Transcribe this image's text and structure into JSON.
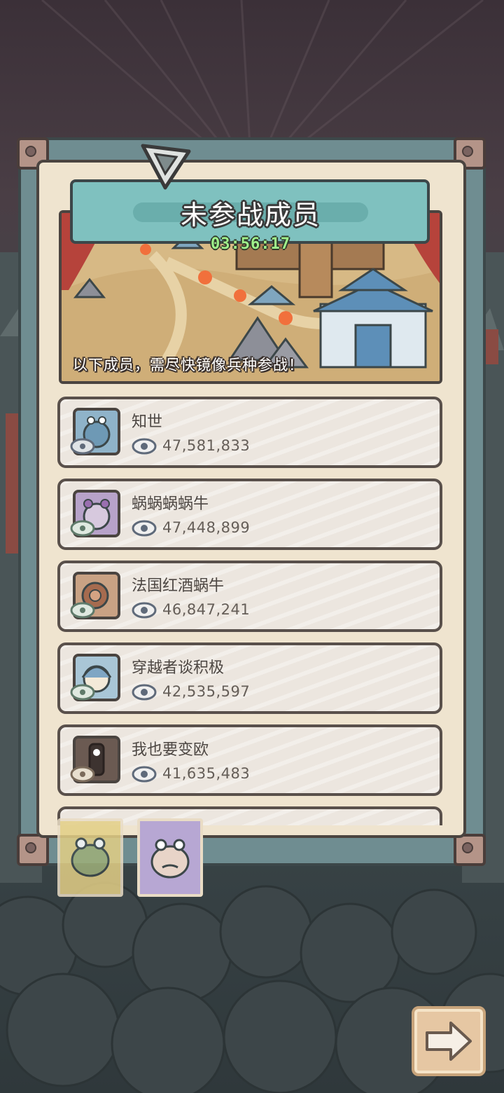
{
  "header": {
    "title": "未参战成员",
    "timer": "03:56:17",
    "caption": "以下成员，需尽快镜像兵种参战！"
  },
  "members": [
    {
      "name": "知世",
      "views": "47,581,833",
      "avatar_color": "#8fb3c9",
      "avatar_icon": "blue-snail-icon"
    },
    {
      "name": "蜗蜗蜗蜗牛",
      "views": "47,448,899",
      "avatar_color": "#b7a2c9",
      "avatar_icon": "purple-snail-icon"
    },
    {
      "name": "法国红酒蜗牛",
      "views": "46,847,241",
      "avatar_color": "#c9a284",
      "avatar_icon": "wine-snail-icon"
    },
    {
      "name": "穿越者谈积极",
      "views": "42,535,597",
      "avatar_color": "#a9c6d6",
      "avatar_icon": "girl-avatar-icon"
    },
    {
      "name": "我也要变欧",
      "views": "41,635,483",
      "avatar_color": "#6b5a52",
      "avatar_icon": "dark-avatar-icon"
    }
  ],
  "tabs": [
    {
      "icon": "yellow-snail-tab-icon",
      "color": "#e3cf86",
      "active": false
    },
    {
      "icon": "purple-snail-tab-icon",
      "color": "#b7a7d3",
      "active": true
    }
  ],
  "next_button": {
    "icon": "arrow-right-icon"
  },
  "colors": {
    "frame": "#6f8d91",
    "panel": "#efe4cf",
    "title_banner": "#7fc1bf",
    "timer": "#9ff18b"
  }
}
